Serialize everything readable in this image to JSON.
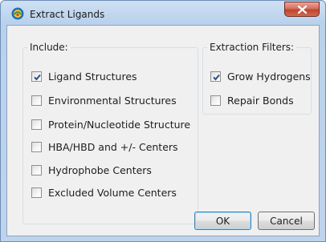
{
  "window": {
    "title": "Extract Ligands"
  },
  "include": {
    "legend": "Include:",
    "items": [
      {
        "label": "Ligand Structures",
        "checked": true
      },
      {
        "label": "Environmental Structures",
        "checked": false
      },
      {
        "label": "Protein/Nucleotide Structure",
        "checked": false
      },
      {
        "label": "HBA/HBD and +/- Centers",
        "checked": false
      },
      {
        "label": "Hydrophobe Centers",
        "checked": false
      },
      {
        "label": "Excluded Volume Centers",
        "checked": false
      }
    ]
  },
  "filters": {
    "legend": "Extraction Filters:",
    "items": [
      {
        "label": "Grow Hydrogens",
        "checked": true
      },
      {
        "label": "Repair Bonds",
        "checked": false
      }
    ]
  },
  "buttons": {
    "ok": "OK",
    "cancel": "Cancel"
  },
  "colors": {
    "accent": "#3c7fb1",
    "close": "#c1432e",
    "check": "#2a4f86"
  }
}
